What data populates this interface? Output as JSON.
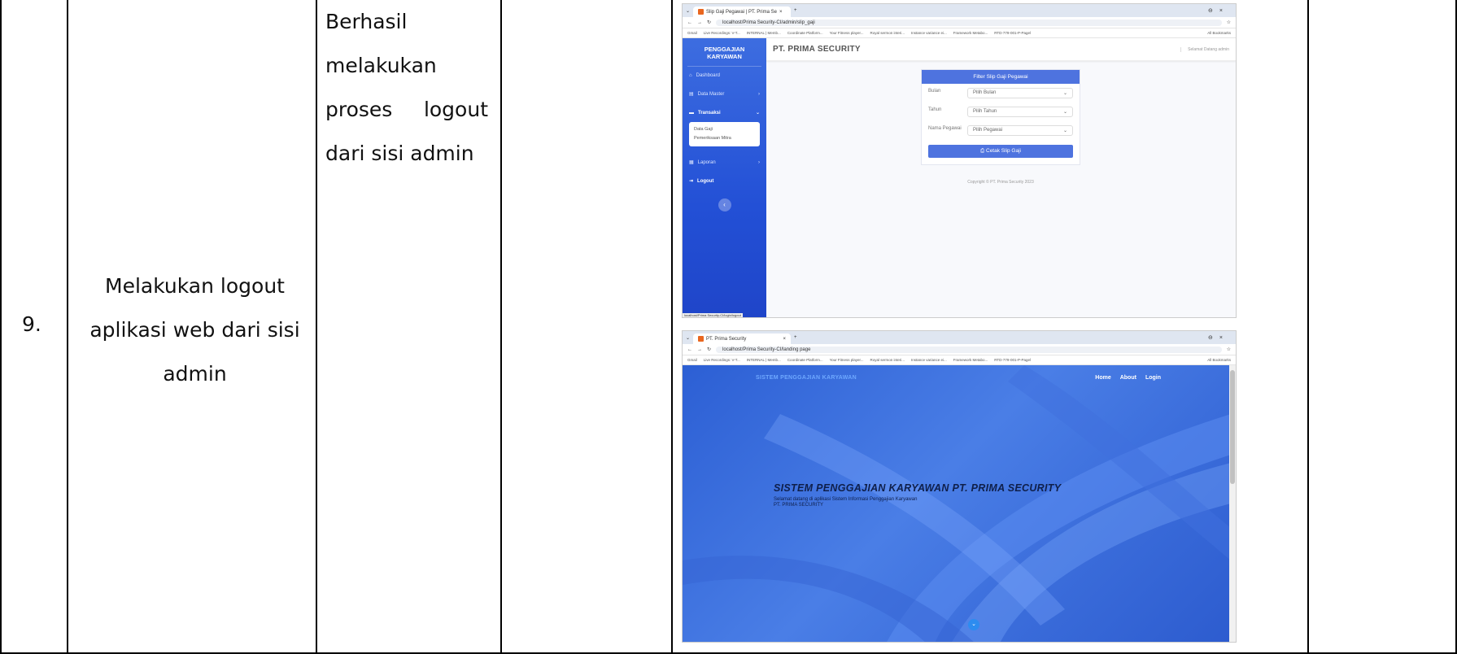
{
  "row": {
    "number": "9.",
    "description_lines": [
      "Melakukan logout",
      "aplikasi web dari sisi",
      "admin"
    ],
    "result_lines": [
      {
        "words": [
          "Berhasil"
        ]
      },
      {
        "words": [
          "melakukan"
        ]
      },
      {
        "words": [
          "proses",
          "logout"
        ]
      },
      {
        "words": [
          "dari sisi admin"
        ]
      }
    ]
  },
  "shot1": {
    "tab_title": "Slip Gaji Pegawai | PT. Prima Se",
    "url": "localhost/Prima Security-CI/admin/slip_gaji",
    "bookmarks": [
      "Gmail",
      "Live Recordings: V-T...",
      "INTERNAL | Memb...",
      "Coordinate Platform...",
      "Your Fitness player...",
      "Royal sermon interi...",
      "Instance variance ei...",
      "Framework Metabo...",
      "RTD-779-001-P-Pagel",
      "All Bookmarks"
    ],
    "brand": "PENGGAJIAN KARYAWAN",
    "nav": [
      {
        "label": "Dashboard",
        "icon": "home-icon",
        "chev": ""
      },
      {
        "label": "Data Master",
        "icon": "database-icon",
        "chev": "›"
      },
      {
        "label": "Transaksi",
        "icon": "transaction-icon",
        "chev": "⌄"
      }
    ],
    "subnav": [
      "Data Gaji",
      "Pemeriksaan Mitra"
    ],
    "nav2": [
      {
        "label": "Laporan",
        "icon": "report-icon",
        "chev": "›"
      },
      {
        "label": "Logout",
        "icon": "logout-icon",
        "chev": ""
      }
    ],
    "collapse_glyph": "‹",
    "status_url": "localhost/Prima Security-CI/login/logout",
    "company": "PT. PRIMA SECURITY",
    "welcome": "Selamat Datang admin",
    "card_title": "Filter Slip Gaji Pegawai",
    "fields": [
      {
        "label": "Bulan",
        "value": "Pilih Bulan"
      },
      {
        "label": "Tahun",
        "value": "Pilih Tahun"
      },
      {
        "label": "Nama Pegawai",
        "value": "Pilih Pegawai"
      }
    ],
    "button": "Cetak Slip Gaji",
    "copyright": "Copyright © PT. Prima Security 2023"
  },
  "shot2": {
    "tab_title": "PT. Prima Security",
    "url": "localhost/Prima Security-CI/landing page",
    "brand": "SISTEM PENGGAJIAN KARYAWAN",
    "nav": [
      "Home",
      "About",
      "Login"
    ],
    "title": "SISTEM PENGGAJIAN KARYAWAN PT. PRIMA SECURITY",
    "subtitle": "Selamat datang di aplikasi Sistem Informasi Penggajian Karyawan",
    "subtitle2": "PT. PRIMA SECURITY",
    "down_glyph": "⌄"
  },
  "colors": {
    "sidebar": "#2350d6",
    "accent": "#4e73df"
  }
}
